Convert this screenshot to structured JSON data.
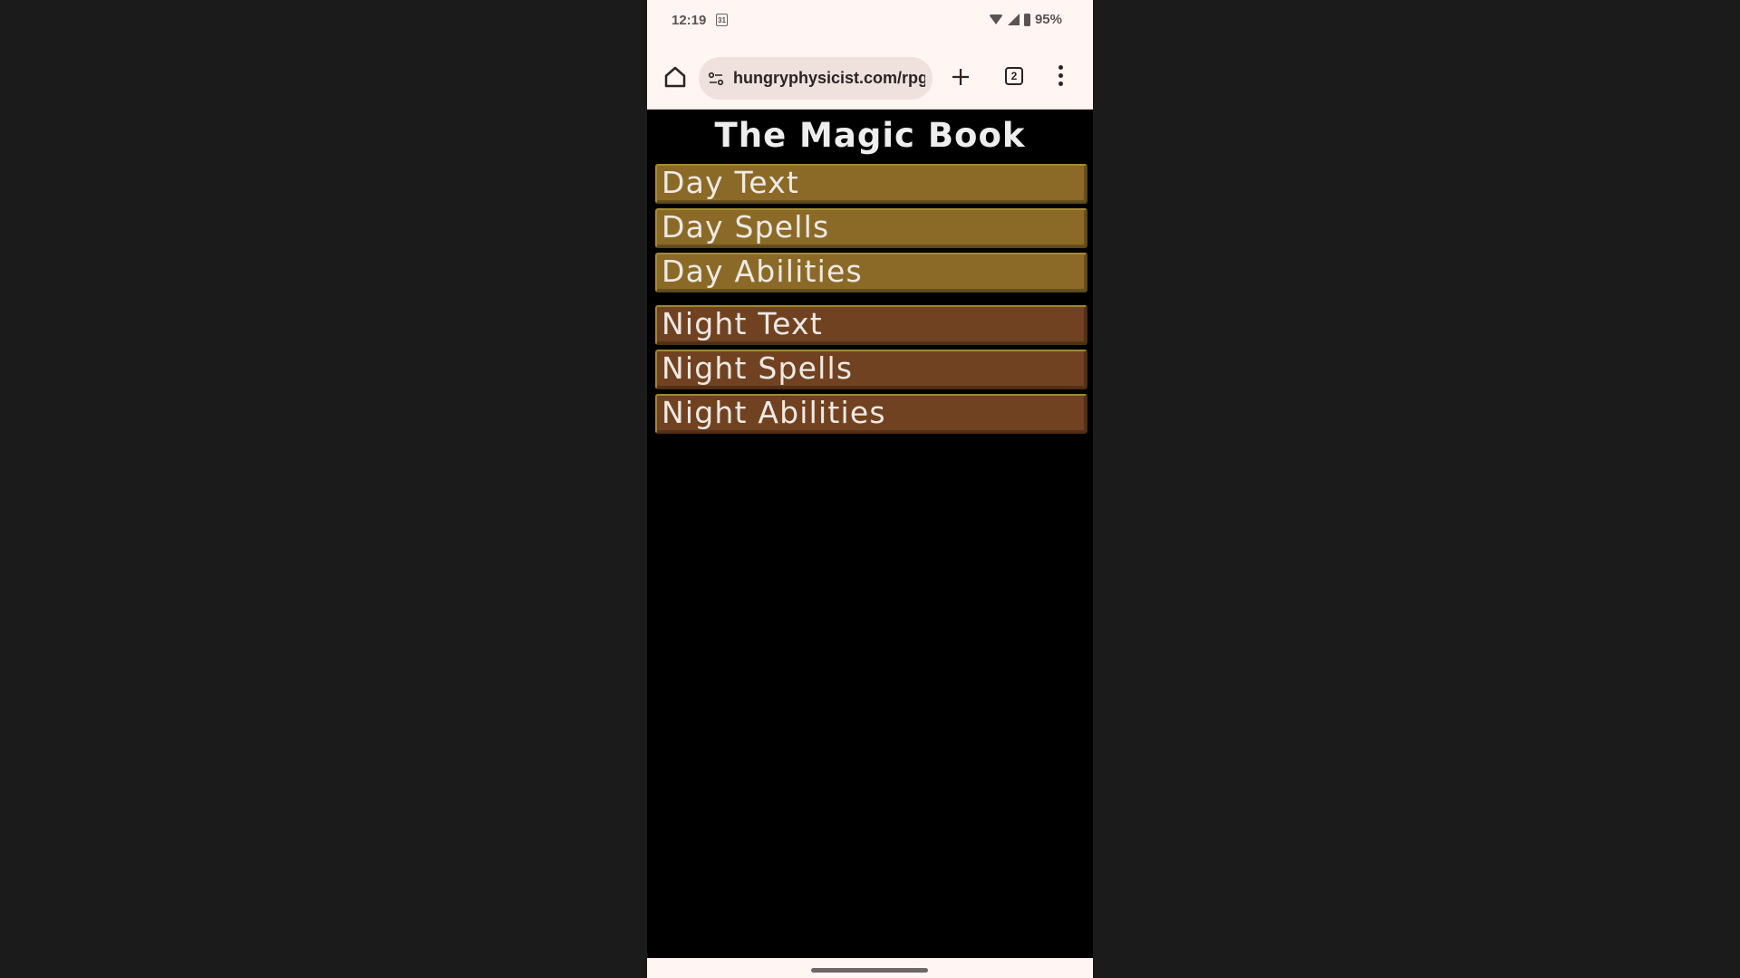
{
  "status_bar": {
    "time": "12:19",
    "calendar_icon_day": "31",
    "battery_percent": "95%",
    "icons": [
      "calendar-icon",
      "wifi-icon",
      "signal-icon",
      "battery-icon"
    ]
  },
  "browser": {
    "url": "hungryphysicist.com/rpg",
    "tab_count": "2",
    "icons": [
      "home-icon",
      "site-settings-icon",
      "plus-icon",
      "tabs-icon",
      "more-vert-icon"
    ]
  },
  "page": {
    "title": "The Magic Book",
    "day_buttons": [
      {
        "label": "Day Text"
      },
      {
        "label": "Day Spells"
      },
      {
        "label": "Day Abilities"
      }
    ],
    "night_buttons": [
      {
        "label": "Night Text"
      },
      {
        "label": "Night Spells"
      },
      {
        "label": "Night Abilities"
      }
    ]
  },
  "colors": {
    "day_button": "#8b6a28",
    "night_button": "#714221",
    "page_background": "#000000",
    "chrome_background": "#fff5f3"
  }
}
